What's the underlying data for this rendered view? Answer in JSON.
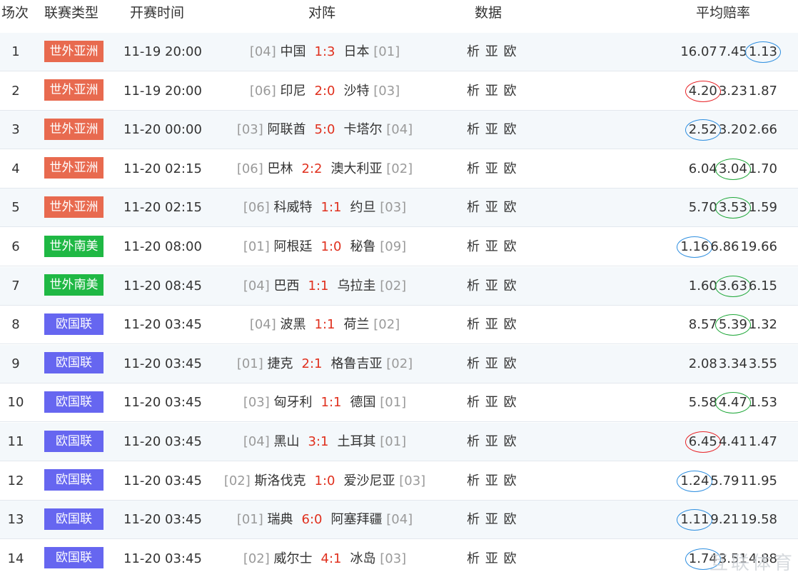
{
  "header": {
    "col_index": "场次",
    "col_league": "联赛类型",
    "col_time": "开赛时间",
    "col_match": "对阵",
    "col_data": "数据",
    "col_odds": "平均赔率"
  },
  "colors": {
    "league_asia": "#e86a4f",
    "league_southamerica": "#1fb844",
    "league_euro": "#6666f0",
    "score": "#e0301e",
    "rank": "#9a9a9a",
    "ring_blue": "#2f8fe0",
    "ring_red": "#e8262a",
    "ring_green": "#20a83a"
  },
  "rows": [
    {
      "index": "1",
      "league": "世外亚洲",
      "league_color": "#e86a4f",
      "time": "11-19 20:00",
      "home_rank": "[04]",
      "home": "中国",
      "score": "1:3",
      "away": "日本",
      "away_rank": "[01]",
      "data_links": "析 亚 欧",
      "odds": [
        "16.07",
        "7.45",
        "1.13"
      ],
      "circled": 2,
      "circle_color": "blue"
    },
    {
      "index": "2",
      "league": "世外亚洲",
      "league_color": "#e86a4f",
      "time": "11-19 20:00",
      "home_rank": "[06]",
      "home": "印尼",
      "score": "2:0",
      "away": "沙特",
      "away_rank": "[03]",
      "data_links": "析 亚 欧",
      "odds": [
        "4.20",
        "3.23",
        "1.87"
      ],
      "circled": 0,
      "circle_color": "red"
    },
    {
      "index": "3",
      "league": "世外亚洲",
      "league_color": "#e86a4f",
      "time": "11-20 00:00",
      "home_rank": "[03]",
      "home": "阿联酋",
      "score": "5:0",
      "away": "卡塔尔",
      "away_rank": "[04]",
      "data_links": "析 亚 欧",
      "odds": [
        "2.52",
        "3.20",
        "2.66"
      ],
      "circled": 0,
      "circle_color": "blue"
    },
    {
      "index": "4",
      "league": "世外亚洲",
      "league_color": "#e86a4f",
      "time": "11-20 02:15",
      "home_rank": "[06]",
      "home": "巴林",
      "score": "2:2",
      "away": "澳大利亚",
      "away_rank": "[02]",
      "data_links": "析 亚 欧",
      "odds": [
        "6.04",
        "3.04",
        "1.70"
      ],
      "circled": 1,
      "circle_color": "green"
    },
    {
      "index": "5",
      "league": "世外亚洲",
      "league_color": "#e86a4f",
      "time": "11-20 02:15",
      "home_rank": "[06]",
      "home": "科威特",
      "score": "1:1",
      "away": "约旦",
      "away_rank": "[03]",
      "data_links": "析 亚 欧",
      "odds": [
        "5.70",
        "3.53",
        "1.59"
      ],
      "circled": 1,
      "circle_color": "green"
    },
    {
      "index": "6",
      "league": "世外南美",
      "league_color": "#1fb844",
      "time": "11-20 08:00",
      "home_rank": "[01]",
      "home": "阿根廷",
      "score": "1:0",
      "away": "秘鲁",
      "away_rank": "[09]",
      "data_links": "析 亚 欧",
      "odds": [
        "1.16",
        "6.86",
        "19.66"
      ],
      "circled": 0,
      "circle_color": "blue"
    },
    {
      "index": "7",
      "league": "世外南美",
      "league_color": "#1fb844",
      "time": "11-20 08:45",
      "home_rank": "[04]",
      "home": "巴西",
      "score": "1:1",
      "away": "乌拉圭",
      "away_rank": "[02]",
      "data_links": "析 亚 欧",
      "odds": [
        "1.60",
        "3.63",
        "6.15"
      ],
      "circled": 1,
      "circle_color": "green"
    },
    {
      "index": "8",
      "league": "欧国联",
      "league_color": "#6666f0",
      "time": "11-20 03:45",
      "home_rank": "[04]",
      "home": "波黑",
      "score": "1:1",
      "away": "荷兰",
      "away_rank": "[02]",
      "data_links": "析 亚 欧",
      "odds": [
        "8.57",
        "5.39",
        "1.32"
      ],
      "circled": 1,
      "circle_color": "green"
    },
    {
      "index": "9",
      "league": "欧国联",
      "league_color": "#6666f0",
      "time": "11-20 03:45",
      "home_rank": "[01]",
      "home": "捷克",
      "score": "2:1",
      "away": "格鲁吉亚",
      "away_rank": "[02]",
      "data_links": "析 亚 欧",
      "odds": [
        "2.08",
        "3.34",
        "3.55"
      ],
      "circled": -1,
      "circle_color": ""
    },
    {
      "index": "10",
      "league": "欧国联",
      "league_color": "#6666f0",
      "time": "11-20 03:45",
      "home_rank": "[03]",
      "home": "匈牙利",
      "score": "1:1",
      "away": "德国",
      "away_rank": "[01]",
      "data_links": "析 亚 欧",
      "odds": [
        "5.58",
        "4.47",
        "1.53"
      ],
      "circled": 1,
      "circle_color": "green"
    },
    {
      "index": "11",
      "league": "欧国联",
      "league_color": "#6666f0",
      "time": "11-20 03:45",
      "home_rank": "[04]",
      "home": "黑山",
      "score": "3:1",
      "away": "土耳其",
      "away_rank": "[01]",
      "data_links": "析 亚 欧",
      "odds": [
        "6.45",
        "4.41",
        "1.47"
      ],
      "circled": 0,
      "circle_color": "red"
    },
    {
      "index": "12",
      "league": "欧国联",
      "league_color": "#6666f0",
      "time": "11-20 03:45",
      "home_rank": "[02]",
      "home": "斯洛伐克",
      "score": "1:0",
      "away": "爱沙尼亚",
      "away_rank": "[03]",
      "data_links": "析 亚 欧",
      "odds": [
        "1.24",
        "5.79",
        "11.95"
      ],
      "circled": 0,
      "circle_color": "blue"
    },
    {
      "index": "13",
      "league": "欧国联",
      "league_color": "#6666f0",
      "time": "11-20 03:45",
      "home_rank": "[01]",
      "home": "瑞典",
      "score": "6:0",
      "away": "阿塞拜疆",
      "away_rank": "[04]",
      "data_links": "析 亚 欧",
      "odds": [
        "1.11",
        "9.21",
        "19.58"
      ],
      "circled": 0,
      "circle_color": "blue"
    },
    {
      "index": "14",
      "league": "欧国联",
      "league_color": "#6666f0",
      "time": "11-20 03:45",
      "home_rank": "[02]",
      "home": "威尔士",
      "score": "4:1",
      "away": "冰岛",
      "away_rank": "[03]",
      "data_links": "析 亚 欧",
      "odds": [
        "1.74",
        "3.51",
        "4.88"
      ],
      "circled": 0,
      "circle_color": "blue"
    }
  ],
  "watermark": "互联体育"
}
